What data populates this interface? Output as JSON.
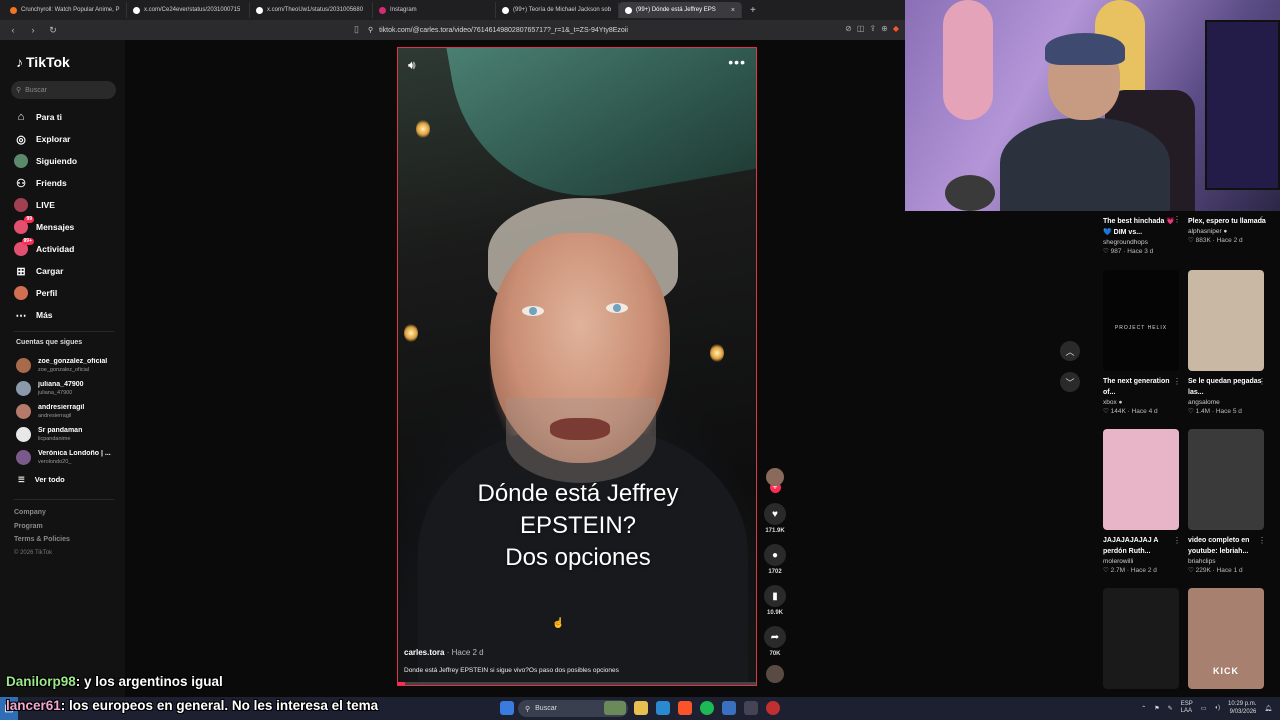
{
  "browser": {
    "tabs": [
      {
        "label": "Crunchyroll: Watch Popular Anime, P",
        "color": "#f47521",
        "active": false
      },
      {
        "label": "x.com/Ce24ever/status/2031000715",
        "color": "#ffffff",
        "active": false
      },
      {
        "label": "x.com/TheoUw1/status/2031005680",
        "color": "#ffffff",
        "active": false
      },
      {
        "label": "Instagram",
        "color": "#d62976",
        "active": false
      },
      {
        "label": "(99+) Teoría de Michael Jackson sob",
        "color": "#ffffff",
        "active": false
      },
      {
        "label": "(99+) Dónde está Jeffrey EPS",
        "color": "#ffffff",
        "active": true
      }
    ],
    "close_glyph": "×",
    "new_tab_glyph": "+",
    "url": "tiktok.com/@carles.tora/video/7614614980280765717?_r=1&_t=ZS-94Yty8Ezoii"
  },
  "tiktok": {
    "logo": "TikTok",
    "search_placeholder": "Buscar",
    "nav": [
      {
        "label": "Para ti",
        "icon": "⌂"
      },
      {
        "label": "Explorar",
        "icon": "◎"
      },
      {
        "label": "Siguiendo",
        "icon": ""
      },
      {
        "label": "Friends",
        "icon": "⚇"
      },
      {
        "label": "LIVE",
        "icon": ""
      },
      {
        "label": "Mensajes",
        "icon": "",
        "badge": "99"
      },
      {
        "label": "Actividad",
        "icon": "",
        "badge": "99+"
      },
      {
        "label": "Cargar",
        "icon": "⊞"
      },
      {
        "label": "Perfil",
        "icon": ""
      },
      {
        "label": "Más",
        "icon": "⋯"
      }
    ],
    "following_title": "Cuentas que sigues",
    "following": [
      {
        "name": "zoe_gonzalez_oficial",
        "handle": "zoe_gonzalez_oficial",
        "color": "#a86a4a"
      },
      {
        "name": "juliana_47900",
        "handle": "juliana_47900",
        "color": "#8a9aaa"
      },
      {
        "name": "andresierragil",
        "handle": "andresierragil",
        "color": "#b57a6a"
      },
      {
        "name": "Sr pandaman",
        "handle": "licpandanime",
        "color": "#e8e8e8"
      },
      {
        "name": "Verónica Londoño | ...",
        "handle": "verolondo20_",
        "color": "#7a5a8a"
      }
    ],
    "see_all": "Ver todo",
    "footer": [
      "Company",
      "Program",
      "Terms & Policies"
    ],
    "copyright": "© 2026 TikTok"
  },
  "video": {
    "caption_lines": [
      "Dónde está Jeffrey",
      "EPSTEIN?",
      "Dos opciones"
    ],
    "author": "carles.tora",
    "when": "· Hace 2 d",
    "description": "Donde está Jeffrey EPSTEIN si sigue vivo?Os paso dos posibles opciones",
    "progress": 0.02,
    "likes": "171.9K",
    "comments": "1702",
    "saves": "10.9K",
    "shares": "70K"
  },
  "feed": [
    {
      "title": "The best hinchada 💗💙 DIM vs...",
      "user": "shegroundhops",
      "stats": "♡ 987 · Hace 3 d",
      "thumb": "#000000",
      "show_thumb": false
    },
    {
      "title": "Plex, espero tu llamada",
      "user": "alphasniper ●",
      "stats": "♡ 883K · Hace 2 d",
      "thumb": "#000000",
      "show_thumb": false
    },
    {
      "title": "The next generation of...",
      "user": "xbox ●",
      "stats": "♡ 144K · Hace 4 d",
      "thumb": "#050505",
      "show_thumb": true,
      "thumb_text": "PROJECT HELIX"
    },
    {
      "title": "Se le quedan pegadas las...",
      "user": "angsalome",
      "stats": "♡ 1.4M · Hace 5 d",
      "thumb": "#c8b8a4",
      "show_thumb": true
    },
    {
      "title": "JAJAJAJAJAJ A perdón Ruth...",
      "user": "molerowilli",
      "stats": "♡ 2.7M · Hace 2 d",
      "thumb": "#e8b4c8",
      "show_thumb": true
    },
    {
      "title": "video completo en youtube: lebriah...",
      "user": "briahclips",
      "stats": "♡ 229K · Hace 1 d",
      "thumb": "#3a3a3a",
      "show_thumb": true
    },
    {
      "title": "",
      "user": "",
      "stats": "",
      "thumb": "#1a1a1a",
      "show_thumb": true
    },
    {
      "title": "",
      "user": "",
      "stats": "",
      "thumb": "#a88070",
      "show_thumb": true,
      "thumb_text": "KICK"
    }
  ],
  "chat": [
    {
      "user": "Danilorp98",
      "message": ": y los argentinos igual"
    },
    {
      "user": "lancer61",
      "message": ": los europeos en general. No les interesa el tema"
    }
  ],
  "taskbar": {
    "search": "Buscar",
    "lang": "ESP\nLAA",
    "time": "10:29 p.m.",
    "date": "9/03/2026"
  }
}
